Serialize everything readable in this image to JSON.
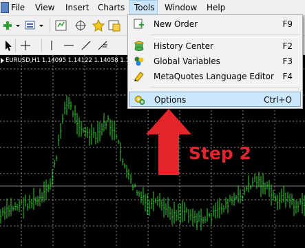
{
  "menubar": {
    "items": [
      {
        "label": "File"
      },
      {
        "label": "View"
      },
      {
        "label": "Insert"
      },
      {
        "label": "Charts"
      },
      {
        "label": "Tools"
      },
      {
        "label": "Window"
      },
      {
        "label": "Help"
      }
    ],
    "active": "Tools"
  },
  "chart": {
    "title": "EURUSD,H1  1.14095 1.14122 1.14058 1.1",
    "line_color": "#2fd32f",
    "grid_color": "#8f8f8f"
  },
  "tools_menu": {
    "items": [
      {
        "label": "New Order",
        "shortcut": "F9",
        "icon": "new-order-icon"
      },
      {
        "label": "History Center",
        "shortcut": "F2",
        "icon": "history-center-icon"
      },
      {
        "label": "Global Variables",
        "shortcut": "F3",
        "icon": "global-variables-icon"
      },
      {
        "label": "MetaQuotes Language Editor",
        "shortcut": "F4",
        "icon": "language-editor-icon"
      },
      {
        "label": "Options",
        "shortcut": "Ctrl+O",
        "icon": "options-icon",
        "highlighted": true
      }
    ]
  },
  "annotation": {
    "label": "Step 2",
    "color": "#e5252b"
  }
}
